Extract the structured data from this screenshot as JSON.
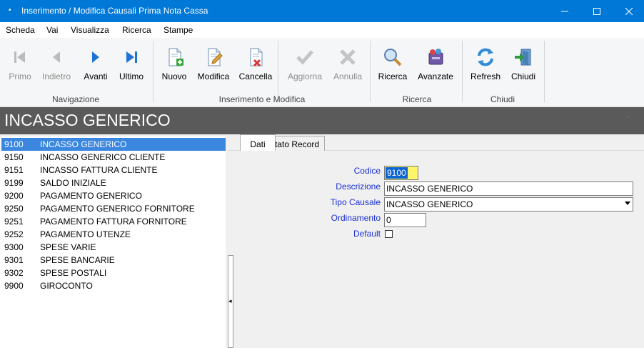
{
  "window": {
    "title": "Inserimento / Modifica Causali Prima Nota Cassa",
    "icon": "dot-icon"
  },
  "menu": [
    "Scheda",
    "Vai",
    "Visualizza",
    "Ricerca",
    "Stampe"
  ],
  "toolbar": {
    "groups": {
      "navigazione": "Navigazione",
      "inserimento": "Inserimento e Modifica",
      "ricerca": "Ricerca",
      "chiudi": "Chiudi"
    },
    "buttons": {
      "primo": "Primo",
      "indietro": "Indietro",
      "avanti": "Avanti",
      "ultimo": "Ultimo",
      "nuovo": "Nuovo",
      "modifica": "Modifica",
      "cancella": "Cancella",
      "aggiorna": "Aggiorna",
      "annulla": "Annulla",
      "ricerca": "Ricerca",
      "avanzate": "Avanzate",
      "refresh": "Refresh",
      "chiudi": "Chiudi"
    }
  },
  "header": {
    "title": "INCASSO GENERICO",
    "marker": "."
  },
  "list": [
    {
      "code": "9100",
      "desc": "INCASSO GENERICO"
    },
    {
      "code": "9150",
      "desc": "INCASSO GENERICO CLIENTE"
    },
    {
      "code": "9151",
      "desc": "INCASSO FATTURA CLIENTE"
    },
    {
      "code": "9199",
      "desc": "SALDO INIZIALE"
    },
    {
      "code": "9200",
      "desc": "PAGAMENTO GENERICO"
    },
    {
      "code": "9250",
      "desc": "PAGAMENTO GENERICO FORNITORE"
    },
    {
      "code": "9251",
      "desc": "PAGAMENTO FATTURA FORNITORE"
    },
    {
      "code": "9252",
      "desc": "PAGAMENTO UTENZE"
    },
    {
      "code": "9300",
      "desc": "SPESE VARIE"
    },
    {
      "code": "9301",
      "desc": "SPESE BANCARIE"
    },
    {
      "code": "9302",
      "desc": "SPESE POSTALI"
    },
    {
      "code": "9900",
      "desc": "GIROCONTO"
    }
  ],
  "tabs": {
    "dati": "Dati",
    "stato": "Stato Record"
  },
  "form": {
    "codice_label": "Codice",
    "codice_value": "9100",
    "descrizione_label": "Descrizione",
    "descrizione_value": "INCASSO GENERICO",
    "tipo_label": "Tipo Causale",
    "tipo_value": "INCASSO GENERICO",
    "ordinamento_label": "Ordinamento",
    "ordinamento_value": "0",
    "default_label": "Default",
    "default_checked": false
  },
  "colors": {
    "titlebar": "#0078d7",
    "header_bg": "#5a5a5a",
    "selected_row": "#3b87e0",
    "field_label": "#1a2fd4",
    "codice_highlight": "#fff46a"
  }
}
